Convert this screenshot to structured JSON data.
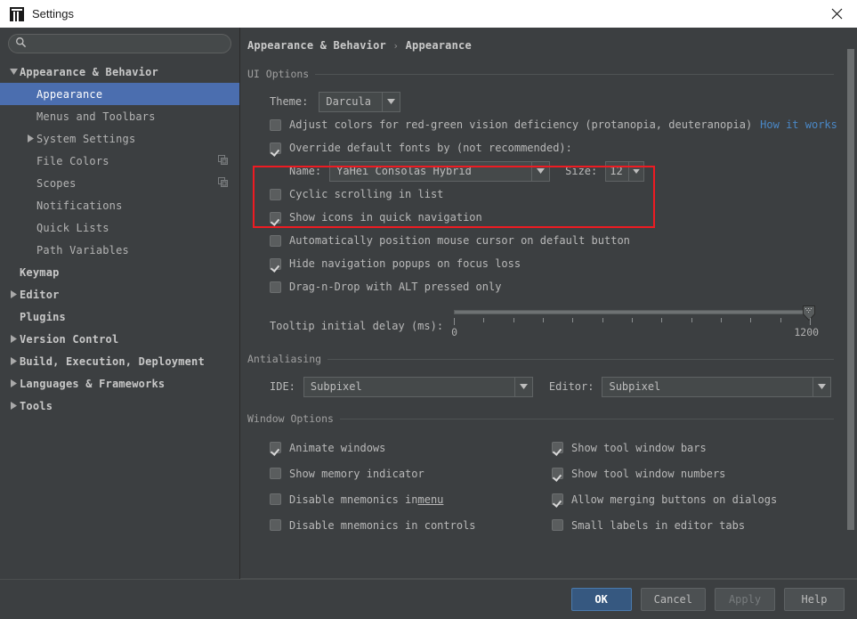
{
  "window": {
    "title": "Settings",
    "logo_icon": "intellij-idea-logo",
    "close_icon": "close-icon"
  },
  "search": {
    "icon": "search-icon",
    "value": "",
    "placeholder": ""
  },
  "sidebar": {
    "items": [
      {
        "label": "Appearance & Behavior",
        "indent": 0,
        "bold": true,
        "twisty": "expanded",
        "selected": false,
        "icon": ""
      },
      {
        "label": "Appearance",
        "indent": 1,
        "bold": false,
        "twisty": "none",
        "selected": true,
        "icon": ""
      },
      {
        "label": "Menus and Toolbars",
        "indent": 1,
        "bold": false,
        "twisty": "none",
        "selected": false,
        "icon": ""
      },
      {
        "label": "System Settings",
        "indent": 1,
        "bold": false,
        "twisty": "collapsed",
        "selected": false,
        "icon": ""
      },
      {
        "label": "File Colors",
        "indent": 1,
        "bold": false,
        "twisty": "none",
        "selected": false,
        "icon": "copy-icon"
      },
      {
        "label": "Scopes",
        "indent": 1,
        "bold": false,
        "twisty": "none",
        "selected": false,
        "icon": "copy-icon"
      },
      {
        "label": "Notifications",
        "indent": 1,
        "bold": false,
        "twisty": "none",
        "selected": false,
        "icon": ""
      },
      {
        "label": "Quick Lists",
        "indent": 1,
        "bold": false,
        "twisty": "none",
        "selected": false,
        "icon": ""
      },
      {
        "label": "Path Variables",
        "indent": 1,
        "bold": false,
        "twisty": "none",
        "selected": false,
        "icon": ""
      },
      {
        "label": "Keymap",
        "indent": 0,
        "bold": true,
        "twisty": "none",
        "selected": false,
        "icon": ""
      },
      {
        "label": "Editor",
        "indent": 0,
        "bold": true,
        "twisty": "collapsed",
        "selected": false,
        "icon": ""
      },
      {
        "label": "Plugins",
        "indent": 0,
        "bold": true,
        "twisty": "none",
        "selected": false,
        "icon": ""
      },
      {
        "label": "Version Control",
        "indent": 0,
        "bold": true,
        "twisty": "collapsed",
        "selected": false,
        "icon": ""
      },
      {
        "label": "Build, Execution, Deployment",
        "indent": 0,
        "bold": true,
        "twisty": "collapsed",
        "selected": false,
        "icon": ""
      },
      {
        "label": "Languages & Frameworks",
        "indent": 0,
        "bold": true,
        "twisty": "collapsed",
        "selected": false,
        "icon": ""
      },
      {
        "label": "Tools",
        "indent": 0,
        "bold": true,
        "twisty": "collapsed",
        "selected": false,
        "icon": ""
      }
    ]
  },
  "breadcrumb": {
    "parent": "Appearance & Behavior",
    "separator": "›",
    "current": "Appearance"
  },
  "ui_options": {
    "group_label": "UI Options",
    "theme_label": "Theme:",
    "theme_value": "Darcula",
    "protanopia_label": "Adjust colors for red-green vision deficiency (protanopia, deuteranopia)",
    "protanopia_checked": false,
    "how_it_works_link": "How it works",
    "override_fonts_label": "Override default fonts by (not recommended):",
    "override_fonts_checked": true,
    "font_name_label": "Name:",
    "font_name_value": "YaHei Consolas Hybrid",
    "font_size_label": "Size:",
    "font_size_value": "12",
    "checkboxes": [
      {
        "label": "Cyclic scrolling in list",
        "checked": false
      },
      {
        "label": "Show icons in quick navigation",
        "checked": true
      },
      {
        "label": "Automatically position mouse cursor on default button",
        "checked": false
      },
      {
        "label": "Hide navigation popups on focus loss",
        "checked": true
      },
      {
        "label": "Drag-n-Drop with ALT pressed only",
        "checked": false
      }
    ],
    "tooltip_delay_label": "Tooltip initial delay (ms):",
    "tooltip_delay_min": "0",
    "tooltip_delay_max": "1200",
    "tooltip_delay_value": 1200
  },
  "antialiasing": {
    "group_label": "Antialiasing",
    "ide_label": "IDE:",
    "ide_value": "Subpixel",
    "editor_label": "Editor:",
    "editor_value": "Subpixel"
  },
  "window_options": {
    "group_label": "Window Options",
    "left_column": [
      {
        "label": "Animate windows",
        "checked": true,
        "mnemonic": ""
      },
      {
        "label": "Show memory indicator",
        "checked": false,
        "mnemonic": ""
      },
      {
        "label": "Disable mnemonics in ",
        "checked": false,
        "mnemonic": "menu"
      },
      {
        "label": "Disable mnemonics in controls",
        "checked": false,
        "mnemonic": ""
      }
    ],
    "right_column": [
      {
        "label": "Show tool window bars",
        "checked": true,
        "mnemonic": ""
      },
      {
        "label": "Show tool window numbers",
        "checked": true,
        "mnemonic": ""
      },
      {
        "label": "Allow merging buttons on dialogs",
        "checked": true,
        "mnemonic": ""
      },
      {
        "label": "Small labels in editor tabs",
        "checked": false,
        "mnemonic": ""
      }
    ]
  },
  "footer": {
    "ok": "OK",
    "cancel": "Cancel",
    "apply": "Apply",
    "help": "Help",
    "apply_disabled": true
  },
  "colors": {
    "accent_selection": "#4b6eaf",
    "default_button": "#365880",
    "link": "#4a88c7",
    "annotation_red": "#ee1b22",
    "panel_bg": "#3c3f41",
    "field_bg": "#45494a"
  }
}
